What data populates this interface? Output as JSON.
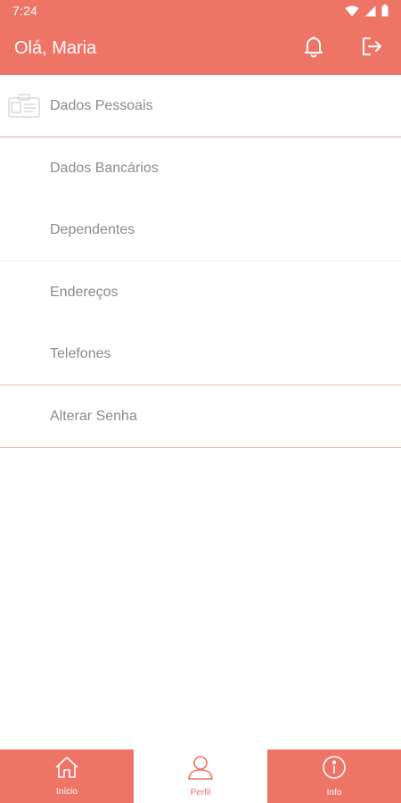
{
  "status_bar": {
    "time": "7:24"
  },
  "header": {
    "greeting": "Olá, Maria"
  },
  "menu": {
    "items": [
      {
        "label": "Dados Pessoais"
      },
      {
        "label": "Dados Bancários"
      },
      {
        "label": "Dependentes"
      },
      {
        "label": "Endereços"
      },
      {
        "label": "Telefones"
      },
      {
        "label": "Alterar Senha"
      }
    ]
  },
  "bottom_nav": {
    "items": [
      {
        "label": "Início",
        "icon": "home-icon",
        "active": false
      },
      {
        "label": "Perfil",
        "icon": "person-icon",
        "active": true
      },
      {
        "label": "Info",
        "icon": "info-icon",
        "active": false
      }
    ]
  },
  "colors": {
    "primary": "#ee7466",
    "divider": "#f4b7af",
    "text_muted": "#8c8c8c",
    "background": "#ffffff"
  }
}
